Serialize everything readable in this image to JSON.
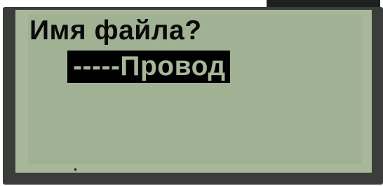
{
  "display": {
    "prompt": "Имя файла?",
    "entry_value": "-----Провод"
  },
  "colors": {
    "bezel": "#3a3d3a",
    "lcd_background": "#a8b79a",
    "text": "#0a0a0a",
    "highlight_background": "#000000"
  }
}
